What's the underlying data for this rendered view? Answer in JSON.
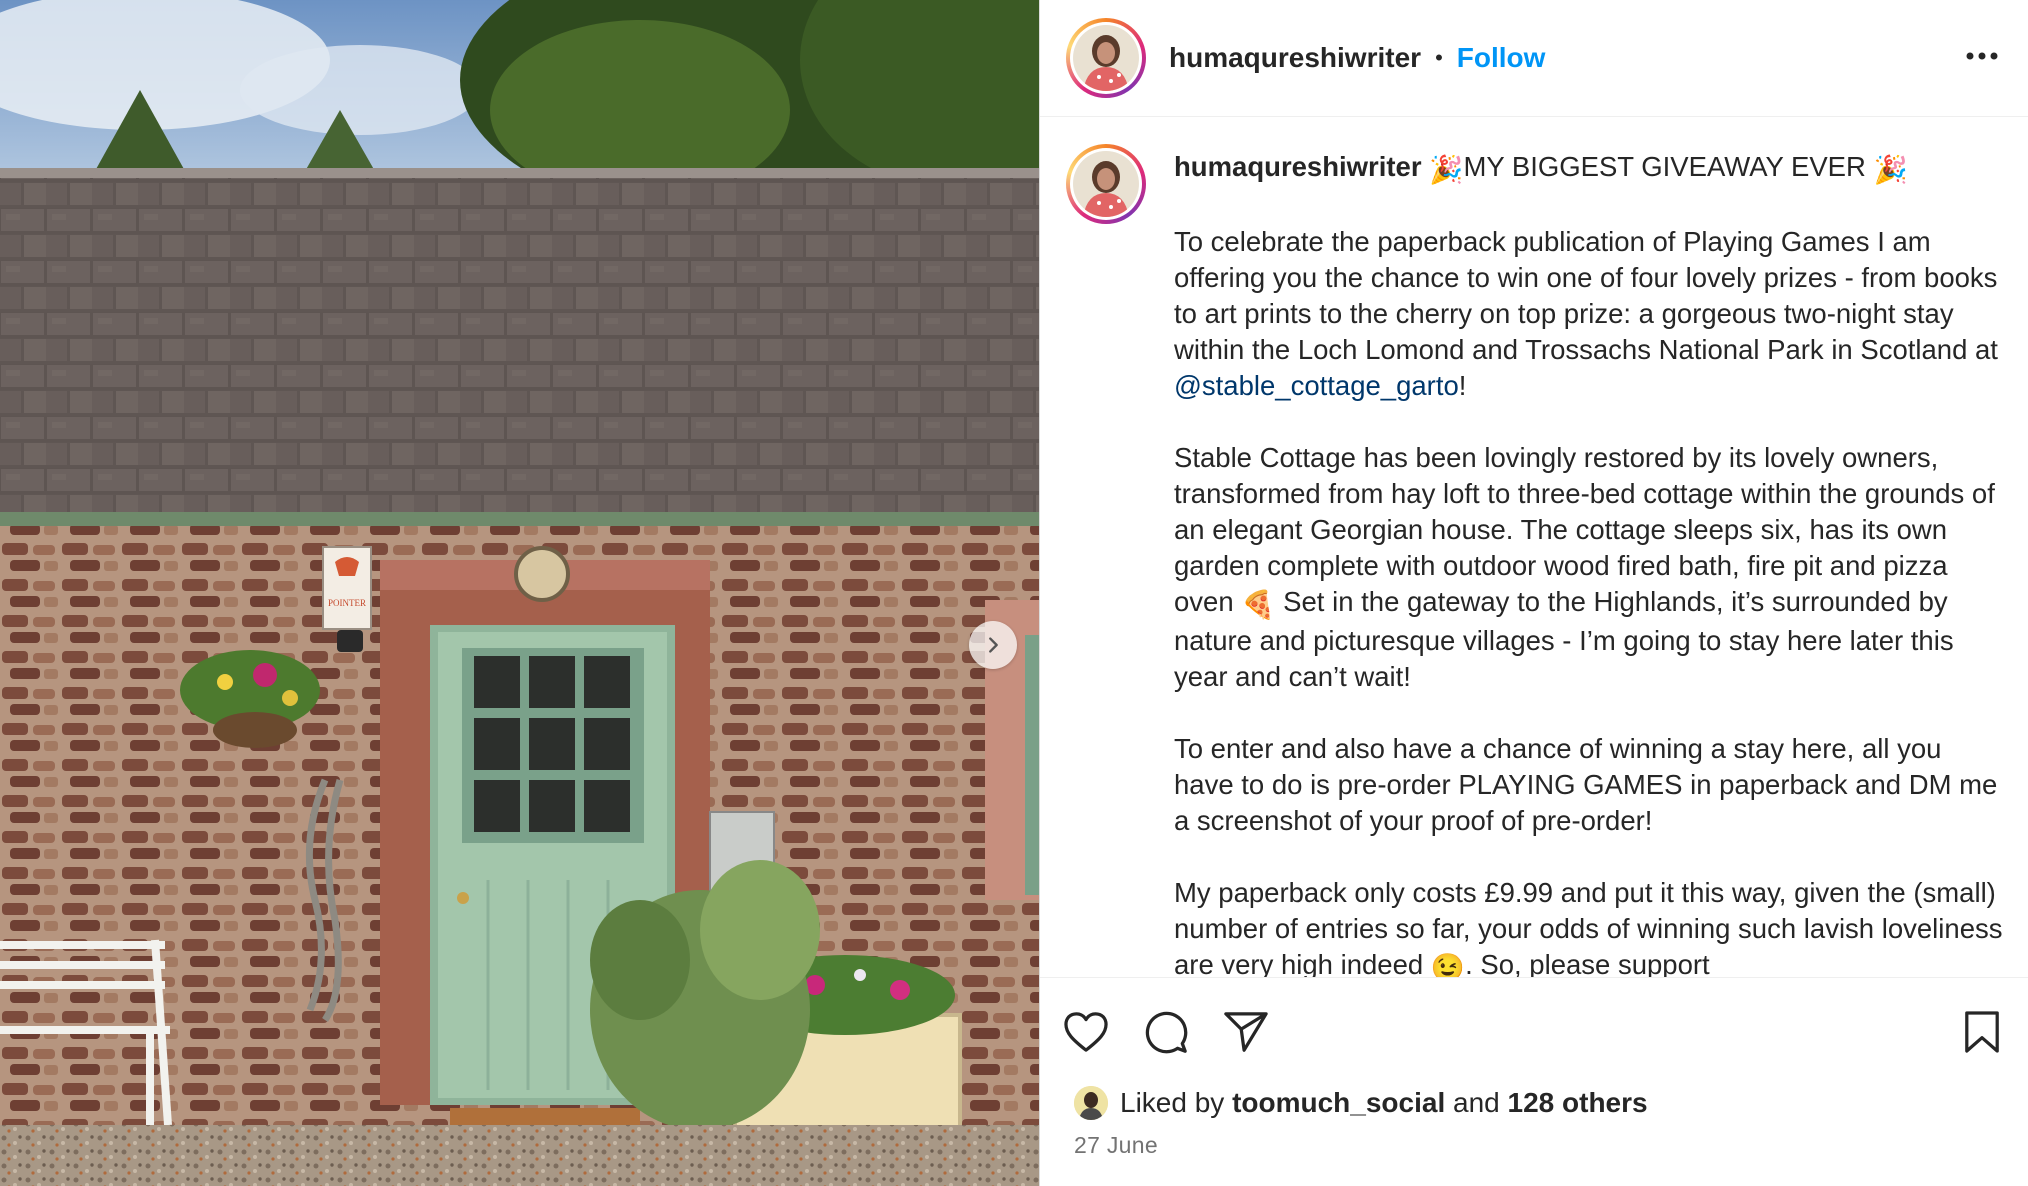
{
  "header": {
    "username": "humaqureshiwriter",
    "separator": "•",
    "follow_label": "Follow",
    "more_icon": "more-options-icon"
  },
  "caption": {
    "username": "humaqureshiwriter",
    "headline_emoji_left": "🎉",
    "headline": "MY BIGGEST GIVEAWAY EVER",
    "headline_emoji_right": "🎉",
    "p1_start": "To celebrate the paperback publication of Playing Games I am offering you the chance to win one of four lovely prizes - from books to art prints to the cherry on top prize: a gorgeous two-night stay within the Loch Lomond and Trossachs National Park in Scotland at ",
    "p1_mention": "@stable_cottage_garto",
    "p1_end": "!",
    "p2_start": "Stable Cottage has been lovingly restored by its lovely owners, transformed from hay loft to three-bed cottage within the grounds of an elegant Georgian house. The cottage sleeps six, has its own garden complete with outdoor wood fired bath, fire pit and pizza oven ",
    "p2_emoji": "🍕",
    "p2_end": " Set in the gateway to the Highlands, it’s surrounded by nature and picturesque villages - I’m going to stay here later this year and can’t wait!",
    "p3": "To enter and also have a chance of winning a stay here, all you have to do is pre-order PLAYING GAMES in paperback and DM me a screenshot of your proof of pre-order!",
    "p4_start": "My paperback only costs £9.99 and put it this way, given the (small) number of entries so far, your odds of winning such lavish loveliness are very high indeed ",
    "p4_emoji": "😉",
    "p4_end": ". So, please support"
  },
  "media": {
    "next_icon": "chevron-right-icon",
    "sign_text": "POINTER"
  },
  "actions": {
    "like_icon": "heart-icon",
    "comment_icon": "comment-icon",
    "share_icon": "send-icon",
    "save_icon": "bookmark-icon"
  },
  "likes": {
    "prefix": "Liked by",
    "liker": "toomuch_social",
    "and": "and",
    "others": "128 others"
  },
  "date": "27 June",
  "colors": {
    "follow": "#0095f6",
    "mention": "#00376b",
    "text": "#262626",
    "secondary": "#737373",
    "door": "#9cc0a4"
  }
}
